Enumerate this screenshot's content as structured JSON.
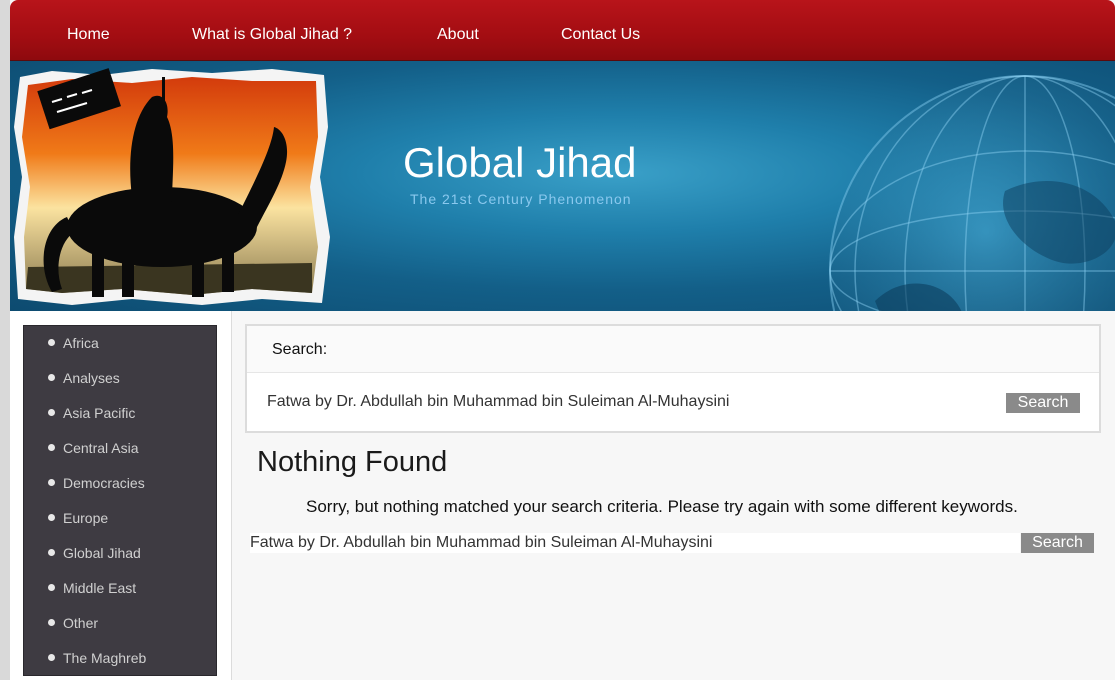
{
  "nav": {
    "items": [
      {
        "label": "Home"
      },
      {
        "label": "What is Global Jihad ?"
      },
      {
        "label": "About"
      },
      {
        "label": "Contact Us"
      }
    ]
  },
  "banner": {
    "title": "Global Jihad",
    "tagline": "The 21st Century Phenomenon"
  },
  "sidebar": {
    "categories": [
      {
        "label": "Africa"
      },
      {
        "label": "Analyses"
      },
      {
        "label": "Asia Pacific"
      },
      {
        "label": "Central Asia"
      },
      {
        "label": "Democracies"
      },
      {
        "label": "Europe"
      },
      {
        "label": "Global Jihad"
      },
      {
        "label": "Middle East"
      },
      {
        "label": "Other"
      },
      {
        "label": "The Maghreb"
      }
    ]
  },
  "search_widget": {
    "heading": "Search:",
    "query": "Fatwa by Dr. Abdullah bin Muhammad bin Suleiman Al-Muhaysini",
    "button_label": "Search"
  },
  "results": {
    "heading": "Nothing Found",
    "message": "Sorry, but nothing matched your search criteria. Please try again with some different keywords.",
    "query": "Fatwa by Dr. Abdullah bin Muhammad bin Suleiman Al-Muhaysini",
    "button_label": "Search"
  },
  "colors": {
    "nav_red": "#a30d12",
    "banner_blue": "#1f7fab",
    "sidebar_dark": "#3e3b42",
    "button_gray": "#8a8a8a"
  }
}
